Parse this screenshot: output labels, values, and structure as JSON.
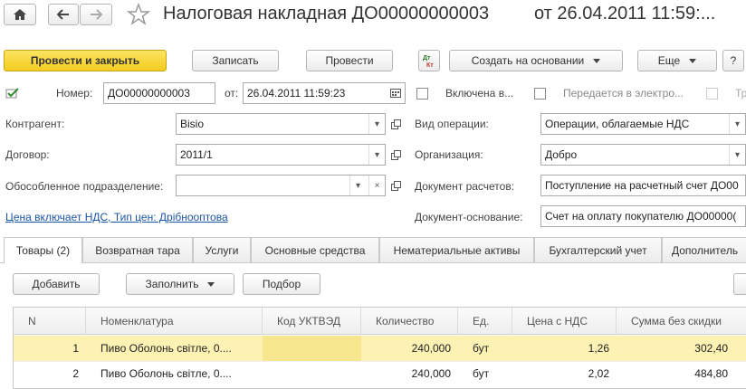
{
  "header": {
    "title": "Налоговая накладная ДО00000000003",
    "date_text": "от 26.04.2011 11:59:..."
  },
  "toolbar": {
    "post_close": "Провести и закрыть",
    "save": "Записать",
    "post": "Провести",
    "dtkt_icon_text": "Дт Кт",
    "create_based": "Создать на основании",
    "more": "Еще",
    "help": "?"
  },
  "form": {
    "number_label": "Номер:",
    "number_value": "ДО00000000003",
    "date_label": "от:",
    "date_value": "26.04.2011 11:59:23",
    "included_label": "Включена в...",
    "transferred_label": "Передается в электро...",
    "cut_label": "Тр",
    "counterparty_label": "Контрагент:",
    "counterparty_value": "Bisio",
    "operation_type_label": "Вид операции:",
    "operation_type_value": "Операции, облагаемые НДС",
    "contract_label": "Договор:",
    "contract_value": "2011/1",
    "organization_label": "Организация:",
    "organization_value": "Добро",
    "subdivision_label": "Обособленное подразделение:",
    "subdivision_value": "",
    "settlement_doc_label": "Документ расчетов:",
    "settlement_doc_value": "Поступление на расчетный счет ДО00",
    "price_link": "Цена включает НДС, Тип цен: Дрібнооптова",
    "base_doc_label": "Документ-основание:",
    "base_doc_value": "Счет на оплату покупателю ДО00000("
  },
  "tabs": [
    {
      "label": "Товары (2)"
    },
    {
      "label": "Возвратная тара"
    },
    {
      "label": "Услуги"
    },
    {
      "label": "Основные средства"
    },
    {
      "label": "Нематериальные активы"
    },
    {
      "label": "Бухгалтерский учет"
    },
    {
      "label": "Дополнитель"
    }
  ],
  "table_toolbar": {
    "add": "Добавить",
    "fill": "Заполнить",
    "select": "Подбор"
  },
  "table": {
    "columns": [
      "N",
      "Номенклатура",
      "Код УКТВЭД",
      "Количество",
      "Ед.",
      "Цена с НДС",
      "Сумма без скидки"
    ],
    "rows": [
      {
        "n": "1",
        "item": "Пиво Оболонь світле, 0....",
        "code": "",
        "qty": "240,000",
        "unit": "бут",
        "price": "1,26",
        "sum": "302,40"
      },
      {
        "n": "2",
        "item": "Пиво Оболонь світле, 0....",
        "code": "",
        "qty": "240,000",
        "unit": "бут",
        "price": "2,02",
        "sum": "484,80"
      }
    ]
  },
  "colors": {
    "primary_button": "#f4cc1f",
    "selected_row": "#fdf2b4",
    "link": "#1a55a6"
  }
}
